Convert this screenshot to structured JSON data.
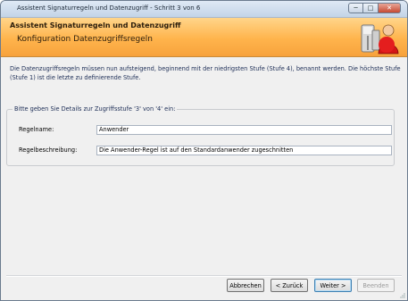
{
  "window": {
    "title": "Assistent Signaturregeln und Datenzugriff - Schritt 3 von 6",
    "controls": {
      "minimize": "─",
      "maximize": "□",
      "close": "✕"
    }
  },
  "header": {
    "title": "Assistent Signaturregeln und Datenzugriff",
    "subtitle": "Konfiguration Datenzugriffsregeln",
    "icon": "keys-user-icon"
  },
  "description": "Die Datenzugriffsregeln müssen nun aufsteigend, beginnend mit der niedrigsten Stufe (Stufe 4), benannt werden. Die höchste Stufe (Stufe 1) ist die letzte zu definierende Stufe.",
  "group": {
    "legend": "Bitte geben Sie Details zur Zugriffsstufe '3' von '4' ein:",
    "rule_name_label": "Regelname:",
    "rule_name_value": "Anwender",
    "rule_desc_label": "Regelbeschreibung:",
    "rule_desc_value": "Die Anwender-Regel ist auf den Standardanwender zugeschnitten"
  },
  "buttons": {
    "cancel": "Abbrechen",
    "back": "< Zurück",
    "next": "Weiter >",
    "finish": "Beenden"
  },
  "colors": {
    "header_top": "#ffd58a",
    "header_bottom": "#f7a23c",
    "window_bg": "#f0f0f0"
  }
}
